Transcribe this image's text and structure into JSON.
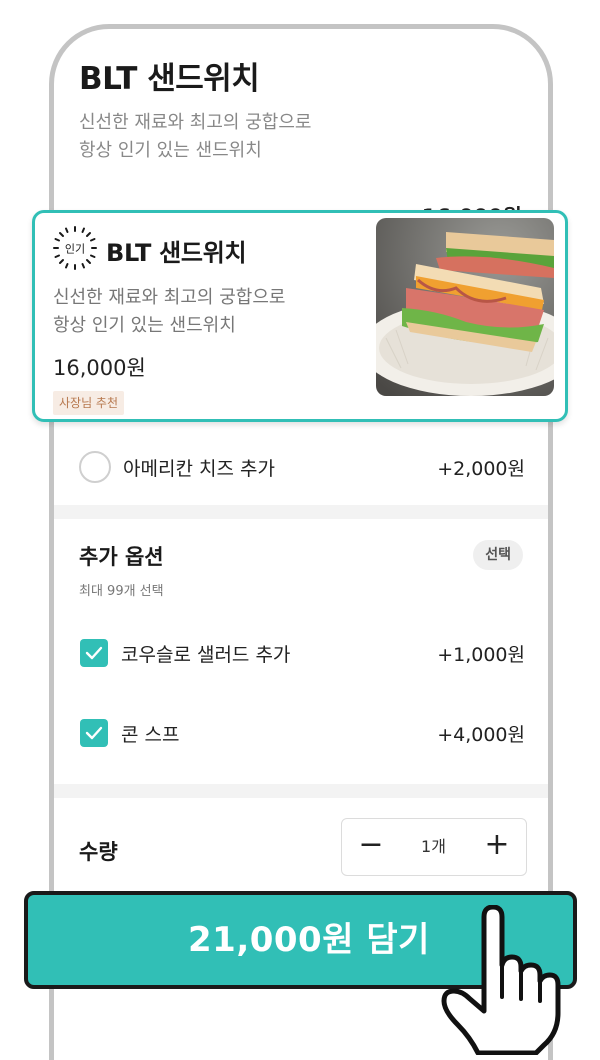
{
  "product": {
    "title": "BLT 샌드위치",
    "desc_line1": "신선한 재료와 최고의 궁합으로",
    "desc_line2": "항상 인기 있는 샌드위치",
    "price_partial": "16,000원"
  },
  "card": {
    "popular_badge": "인기",
    "title": "BLT 샌드위치",
    "desc_line1": "신선한 재료와 최고의 궁합으로",
    "desc_line2": "항상 인기 있는 샌드위치",
    "price": "16,000원",
    "owner_badge": "사장님 추천"
  },
  "option_cheese": {
    "label": "아메리칸 치즈 추가",
    "price": "+2,000원",
    "selected": false
  },
  "extra_options": {
    "title": "추가 옵션",
    "subtitle": "최대 99개 선택",
    "badge": "선택",
    "items": [
      {
        "label": "코우슬로 샐러드 추가",
        "price": "+1,000원",
        "checked": true
      },
      {
        "label": "콘 스프",
        "price": "+4,000원",
        "checked": true
      }
    ]
  },
  "quantity": {
    "label": "수량",
    "value": "1개",
    "minus": "−",
    "plus": "+"
  },
  "cta": {
    "label": "21,000원 담기"
  },
  "colors": {
    "accent": "#31bfb6",
    "owner_badge_bg": "#f7ece4",
    "owner_badge_text": "#b7784e"
  },
  "icons": [
    "popular-badge-icon",
    "check-icon",
    "radio-icon",
    "minus-icon",
    "plus-icon",
    "pointing-hand-icon"
  ]
}
